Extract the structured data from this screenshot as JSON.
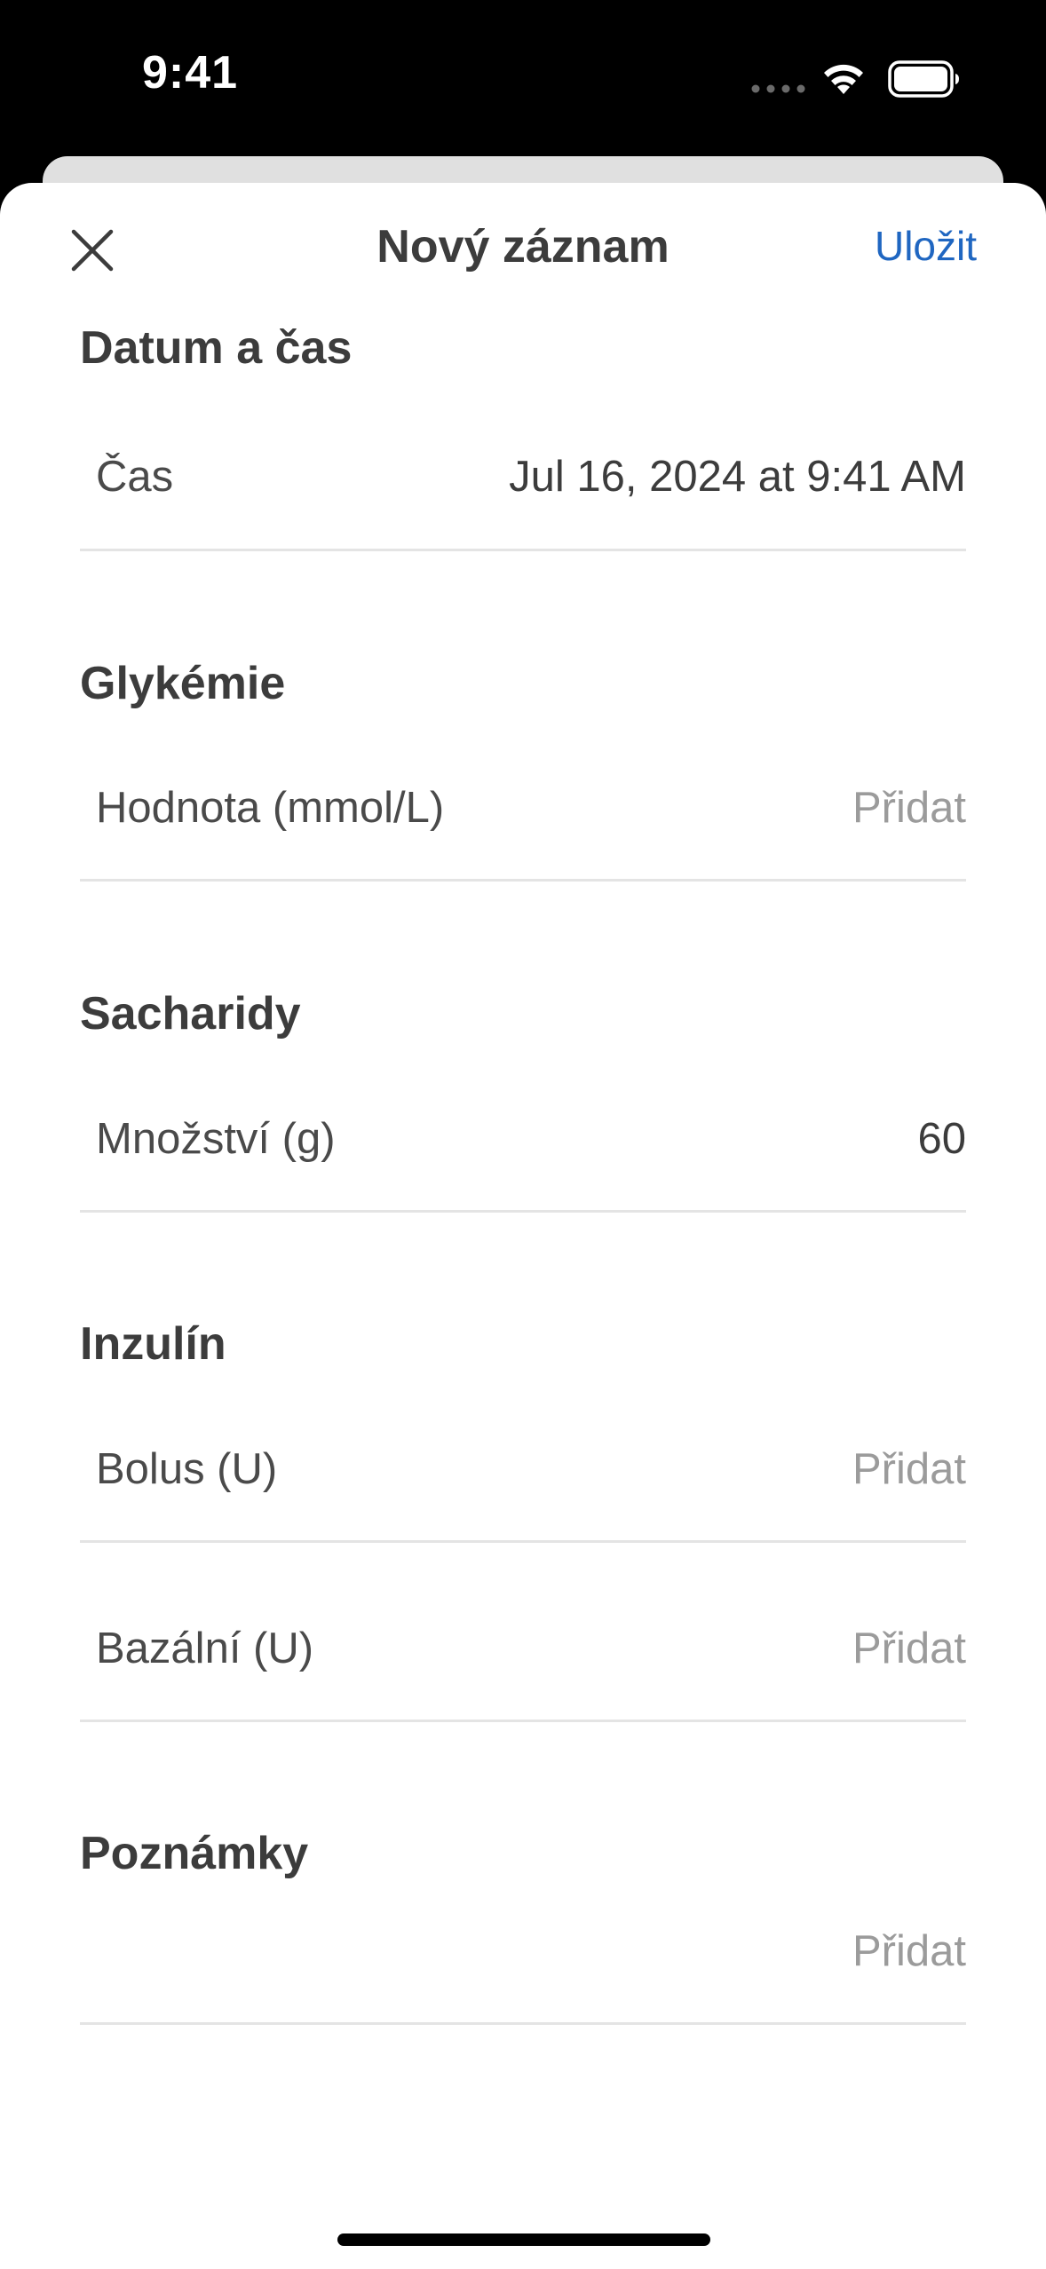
{
  "status_bar": {
    "time": "9:41"
  },
  "nav": {
    "title": "Nový záznam",
    "save_label": "Uložit",
    "close_icon": "close-icon"
  },
  "sections": {
    "datetime": {
      "header": "Datum a čas",
      "time_label": "Čas",
      "time_value": "Jul 16, 2024 at 9:41 AM"
    },
    "glycemia": {
      "header": "Glykémie",
      "value_label": "Hodnota (mmol/L)",
      "value_placeholder": "Přidat"
    },
    "carbs": {
      "header": "Sacharidy",
      "amount_label": "Množství (g)",
      "amount_value": "60"
    },
    "insulin": {
      "header": "Inzulín",
      "bolus_label": "Bolus (U)",
      "bolus_placeholder": "Přidat",
      "basal_label": "Bazální (U)",
      "basal_placeholder": "Přidat"
    },
    "notes": {
      "header": "Poznámky",
      "placeholder": "Přidat"
    }
  },
  "colors": {
    "accent": "#1f66c1",
    "text_primary": "#3c3c3c",
    "text_placeholder": "#9b9b9b",
    "divider": "#e4e4e4"
  }
}
